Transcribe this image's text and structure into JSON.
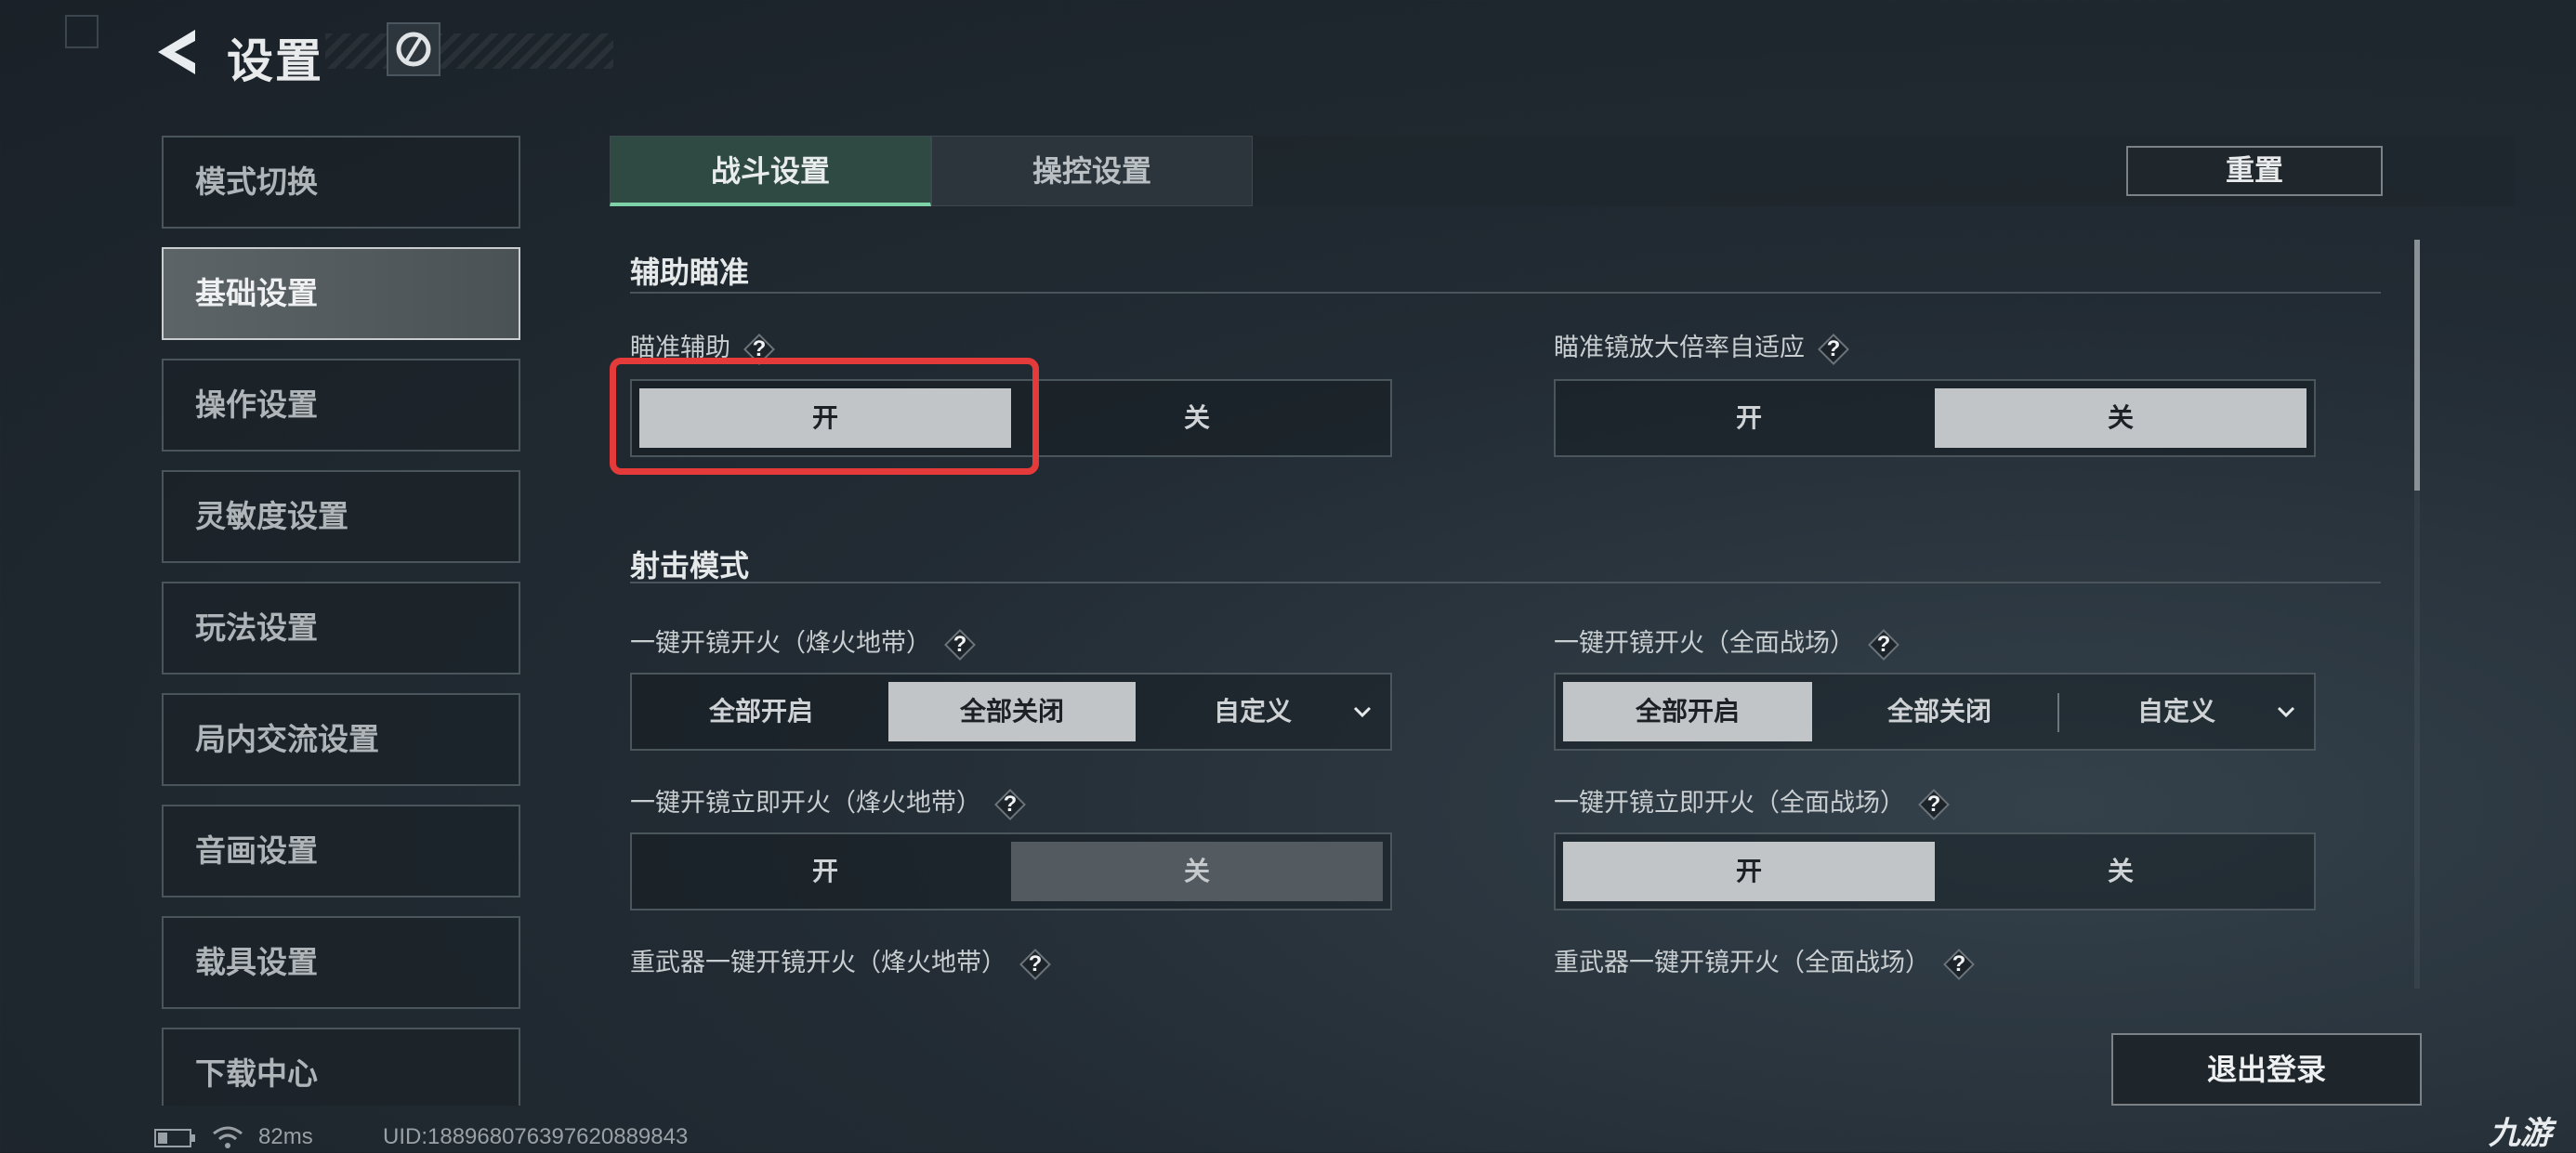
{
  "header": {
    "title": "设置",
    "back_icon": "back-arrow-icon",
    "logo_icon": "game-logo-icon"
  },
  "sidebar": {
    "items": [
      {
        "label": "模式切换"
      },
      {
        "label": "基础设置",
        "active": true
      },
      {
        "label": "操作设置"
      },
      {
        "label": "灵敏度设置"
      },
      {
        "label": "玩法设置"
      },
      {
        "label": "局内交流设置"
      },
      {
        "label": "音画设置"
      },
      {
        "label": "载具设置"
      },
      {
        "label": "下载中心"
      }
    ]
  },
  "tabs": [
    {
      "label": "战斗设置",
      "active": true
    },
    {
      "label": "操控设置"
    }
  ],
  "reset_label": "重置",
  "help_glyph": "?",
  "sections": {
    "aim": {
      "title": "辅助瞄准",
      "aim_assist": {
        "label": "瞄准辅助",
        "options": [
          "开",
          "关"
        ],
        "selected": "开"
      },
      "scope_adapt": {
        "label": "瞄准镜放大倍率自适应",
        "options": [
          "开",
          "关"
        ],
        "selected": "关"
      }
    },
    "fire": {
      "title": "射击模式",
      "one_key_scope_warzone": {
        "label": "一键开镜开火（烽火地带）",
        "options": [
          "全部开启",
          "全部关闭",
          "自定义"
        ],
        "selected": "全部关闭"
      },
      "one_key_scope_fullbattle": {
        "label": "一键开镜开火（全面战场）",
        "options": [
          "全部开启",
          "全部关闭",
          "自定义"
        ],
        "selected": "全部开启"
      },
      "instant_fire_warzone": {
        "label": "一键开镜立即开火（烽火地带）",
        "options": [
          "开",
          "关"
        ],
        "selected": "关"
      },
      "instant_fire_fullbattle": {
        "label": "一键开镜立即开火（全面战场）",
        "options": [
          "开",
          "关"
        ],
        "selected": "开"
      },
      "heavy_warzone": {
        "label": "重武器一键开镜开火（烽火地带）"
      },
      "heavy_fullbattle": {
        "label": "重武器一键开镜开火（全面战场）"
      }
    }
  },
  "logout_label": "退出登录",
  "status": {
    "ping": "82ms",
    "uid": "UID:1889680763976208898​43"
  },
  "watermark": "九游",
  "colors": {
    "accent": "#7ed2a8",
    "highlight": "#e53a3a"
  }
}
